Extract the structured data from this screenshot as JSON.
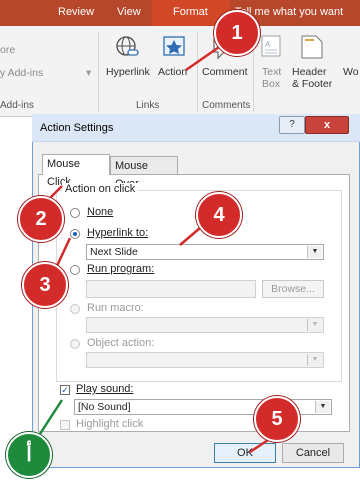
{
  "ribbon": {
    "tabs": [
      "Review",
      "View",
      "Format",
      "Tell me what you want"
    ],
    "left_partial": [
      "ore",
      "y Add-ins",
      "Add-ins"
    ],
    "buttons": {
      "hyperlink": "Hyperlink",
      "action": "Action",
      "comment": "Comment",
      "text_box": "Text\nBox",
      "header_footer": "Header\n& Footer",
      "wordart_partial": "Wo"
    },
    "groups": [
      "Links",
      "Comments"
    ]
  },
  "dialog": {
    "title": "Action Settings",
    "help": "?",
    "close": "x",
    "tabs": [
      "Mouse Click",
      "Mouse Over"
    ],
    "group_label": "Action on click",
    "options": {
      "none": "None",
      "hyperlink_to": "Hyperlink to:",
      "run_program": "Run program:",
      "run_macro": "Run macro:",
      "object_action": "Object action:"
    },
    "hyperlink_value": "Next Slide",
    "browse": "Browse...",
    "play_sound": "Play sound:",
    "sound_value": "[No Sound]",
    "highlight_click": "Highlight click",
    "ok": "OK",
    "cancel": "Cancel"
  },
  "callouts": [
    "1",
    "2",
    "3",
    "4",
    "5",
    "أ"
  ],
  "colors": {
    "callout_red": "#d32a2a",
    "callout_green": "#1e8a3c",
    "ribbon": "#b7472a"
  }
}
